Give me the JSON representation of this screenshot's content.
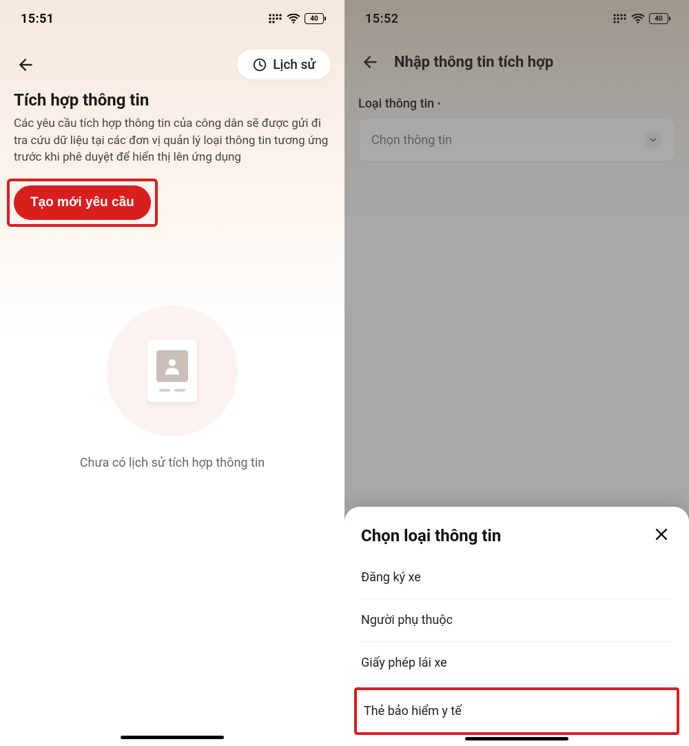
{
  "screen1": {
    "status": {
      "time": "15:51",
      "battery": "40"
    },
    "nav": {
      "history_label": "Lịch sử"
    },
    "title": "Tích hợp thông tin",
    "description": "Các yêu cầu tích hợp thông tin của công dân sẽ được gửi đi tra cứu dữ liệu tại các đơn vị quản lý loại thông tin tương ứng trước khi phê duyệt để hiển thị lên ứng dụng",
    "create_button": "Tạo mới yêu cầu",
    "empty_message": "Chưa có lịch sử tích hợp thông tin"
  },
  "screen2": {
    "status": {
      "time": "15:52",
      "battery": "40"
    },
    "title": "Nhập thông tin tích hợp",
    "form": {
      "info_type_label": "Loại thông tin",
      "select_placeholder": "Chọn thông tin"
    },
    "sheet": {
      "title": "Chọn loại thông tin",
      "options": [
        "Đăng ký xe",
        "Người phụ thuộc",
        "Giấy phép lái xe",
        "Thẻ bảo hiểm y tế"
      ]
    }
  }
}
